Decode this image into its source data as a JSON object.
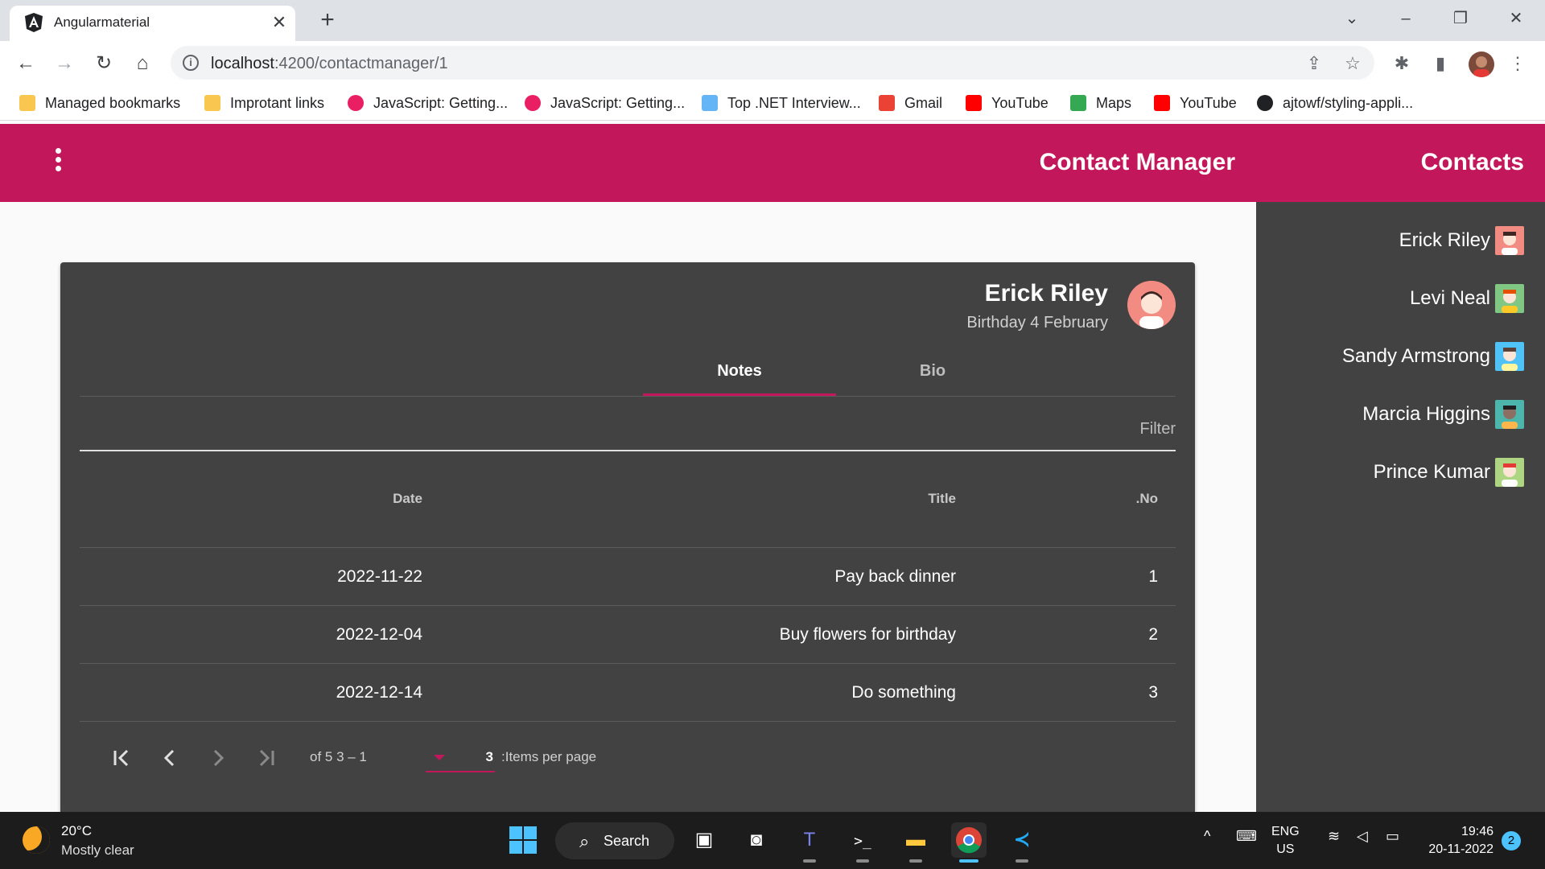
{
  "browser": {
    "tab_title": "Angularmaterial",
    "url_host": "localhost",
    "url_rest": ":4200/contactmanager/1",
    "bookmarks": [
      {
        "label": "Managed bookmarks",
        "color": "#f9c74f"
      },
      {
        "label": "Improtant links",
        "color": "#f9c74f"
      },
      {
        "label": "JavaScript: Getting...",
        "color": "#e91e63"
      },
      {
        "label": "JavaScript: Getting...",
        "color": "#e91e63"
      },
      {
        "label": "Top .NET Interview...",
        "color": "#64b5f6"
      },
      {
        "label": "Gmail",
        "color": "#ea4335"
      },
      {
        "label": "YouTube",
        "color": "#ff0000"
      },
      {
        "label": "Maps",
        "color": "#34a853"
      },
      {
        "label": "YouTube",
        "color": "#ff0000"
      },
      {
        "label": "ajtowf/styling-appli...",
        "color": "#202124"
      }
    ]
  },
  "app": {
    "title": "Contact Manager",
    "accent": "#c2185b",
    "sidenav": {
      "title": "Contacts",
      "contacts": [
        {
          "name": "Erick Riley",
          "avatar_color": "#f28b82"
        },
        {
          "name": "Levi Neal",
          "avatar_color": "#81c784"
        },
        {
          "name": "Sandy Armstrong",
          "avatar_color": "#4fc3f7"
        },
        {
          "name": "Marcia Higgins",
          "avatar_color": "#4db6ac"
        },
        {
          "name": "Prince Kumar",
          "avatar_color": "#aed581"
        }
      ]
    },
    "card": {
      "name": "Erick Riley",
      "subtitle": "Birthday 4 February",
      "tabs": [
        "Notes",
        "Bio"
      ],
      "active_tab": "Notes",
      "filter_label": "Filter",
      "table": {
        "headers": {
          "date": "Date",
          "title": "Title",
          "no": ".No"
        },
        "rows": [
          {
            "date": "2022-11-22",
            "title": "Pay back dinner",
            "no": "1"
          },
          {
            "date": "2022-12-04",
            "title": "Buy flowers for birthday",
            "no": "2"
          },
          {
            "date": "2022-12-14",
            "title": "Do something",
            "no": "3"
          }
        ]
      },
      "paginator": {
        "range_label": "of 5 3 – 1",
        "page_size": "3",
        "items_per_page_label": ":Items per page"
      }
    }
  },
  "taskbar": {
    "weather_temp": "20°C",
    "weather_desc": "Mostly clear",
    "search_label": "Search",
    "lang_line1": "ENG",
    "lang_line2": "US",
    "time": "19:46",
    "date": "20-11-2022",
    "notification_count": "2"
  }
}
